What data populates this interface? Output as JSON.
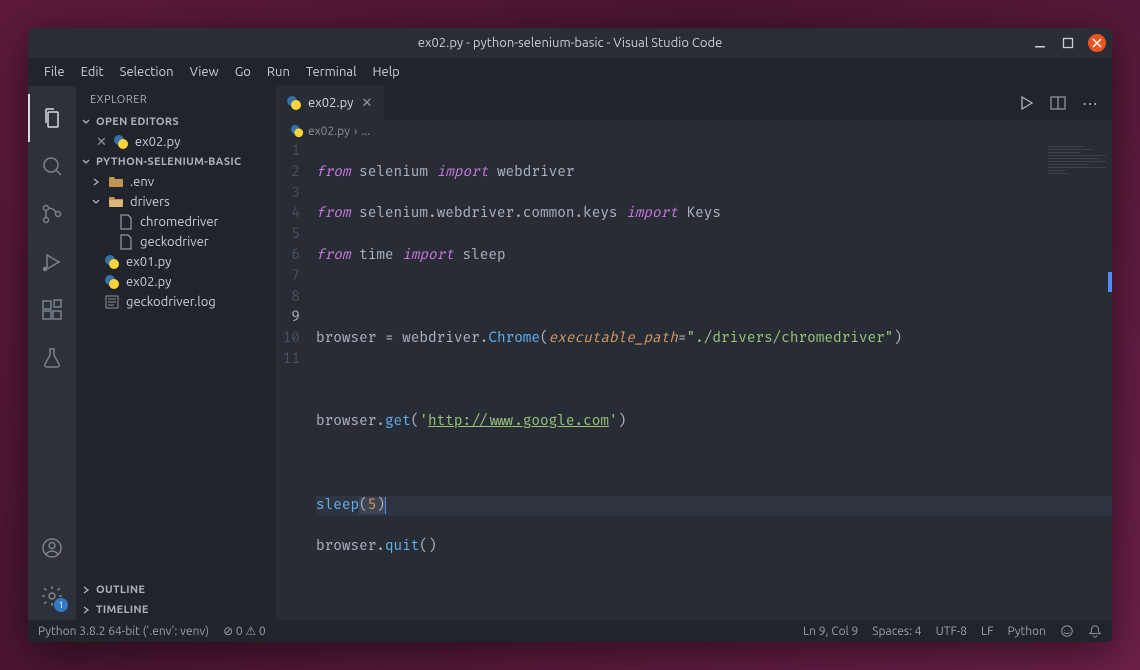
{
  "titlebar": {
    "title": "ex02.py - python-selenium-basic - Visual Studio Code"
  },
  "menu": [
    "File",
    "Edit",
    "Selection",
    "View",
    "Go",
    "Run",
    "Terminal",
    "Help"
  ],
  "sidebar": {
    "header": "EXPLORER",
    "sections": {
      "open_editors": "OPEN EDITORS",
      "project": "PYTHON-SELENIUM-BASIC",
      "outline": "OUTLINE",
      "timeline": "TIMELINE"
    },
    "open_editor_item": "ex02.py",
    "tree": {
      "env": ".env",
      "drivers": "drivers",
      "chromedriver": "chromedriver",
      "geckodriver": "geckodriver",
      "ex01": "ex01.py",
      "ex02": "ex02.py",
      "log": "geckodriver.log"
    }
  },
  "tab": {
    "label": "ex02.py"
  },
  "breadcrumb": {
    "file": "ex02.py",
    "more": "..."
  },
  "code": {
    "lines": 11,
    "content_tokens": {
      "l1": [
        "from",
        " selenium ",
        "import",
        " webdriver"
      ],
      "l2": [
        "from",
        " selenium.webdriver.common.keys ",
        "import",
        " Keys"
      ],
      "l3": [
        "from",
        " time ",
        "import",
        " sleep"
      ],
      "l5_a": "browser ",
      "l5_b": "=",
      "l5_c": " webdriver.",
      "l5_d": "Chrome",
      "l5_e": "(",
      "l5_f": "executable_path",
      "l5_g": "=",
      "l5_h": "\"./drivers/chromedriver\"",
      "l5_i": ")",
      "l7_a": "browser.",
      "l7_b": "get",
      "l7_c": "(",
      "l7_d": "'",
      "l7_e": "http://www.google.com",
      "l7_f": "'",
      "l7_g": ")",
      "l9_a": "sleep",
      "l9_b": "(",
      "l9_c": "5",
      "l9_d": ")",
      "l10_a": "browser.",
      "l10_b": "quit",
      "l10_c": "()"
    }
  },
  "status": {
    "interpreter": "Python 3.8.2 64-bit ('.env': venv)",
    "errors": "0",
    "warnings": "0",
    "ln_col": "Ln 9, Col 9",
    "spaces": "Spaces: 4",
    "encoding": "UTF-8",
    "eol": "LF",
    "lang": "Python",
    "feedback": "",
    "bell": ""
  },
  "activity_badge": "1"
}
